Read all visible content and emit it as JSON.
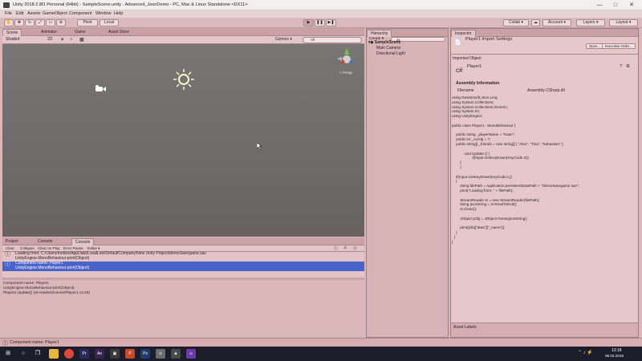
{
  "window": {
    "title": "Unity 2018.2.8f1 Personal (64bit) - SampleScene.unity - Advanced_JsonDemo - PC, Mac & Linux Standalone <DX11>",
    "controls": [
      "—",
      "□",
      "✕"
    ]
  },
  "menu": [
    "File",
    "Edit",
    "Assets",
    "GameObject",
    "Component",
    "Window",
    "Help"
  ],
  "toolbar": {
    "pivot": "Pivot",
    "local": "Local",
    "play_icon": "play-icon",
    "pause_icon": "pause-icon",
    "step_icon": "step-icon",
    "collab": "Collab ▾",
    "account": "Account ▾",
    "layers": "Layers ▾",
    "layout": "Layout ▾"
  },
  "scene_tabs": [
    "Scene",
    "Animator",
    "Game",
    "Asset Store"
  ],
  "scene_bar": {
    "shading": "Shaded",
    "mode": "2D",
    "gizmos": "Gizmos ▾",
    "search": "All"
  },
  "scene": {
    "persp": "< Persp"
  },
  "hierarchy": {
    "tab": "Hierarchy",
    "create": "Create ▾",
    "search": "All",
    "scene": "SampleScene",
    "items": [
      "Main Camera",
      "Directional Light"
    ]
  },
  "inspector": {
    "tab": "Inspector",
    "header": "Player1 Import Settings",
    "open": "Open...",
    "exec_order": "Execution Order...",
    "imported_label": "Imported Object",
    "object_name": "Player1",
    "assembly_title": "Assembly Information",
    "filename_label": "Filename",
    "filename_value": "Assembly-CSharp.dll",
    "code": "using Newtonsoft.Json.Linq;\nusing System.Collections;\nusing System.Collections.Generic;\nusing System.IO;\nusing UnityEngine;\n\npublic class Player1 : MonoBehaviour {\n\n    public string _playerName = \"Kaan\";\n    public int _curHp = ?;\n    public string[] _friends = new string[] { \"Alex\", \"Tina\", \"Sebastian\" };\n\n            void Update () {\n                    if(Input.GetKeyDown(KeyCode.S))\n        {\n        }\n\n    if(Input.GetKeyDown(KeyCode.L))\n    {\n        string filePath = Application.persistentDataPath + \"/demoSavegame.sav\";\n        print(\"Loading from: \" + filePath);\n\n        StreamReader sr = new StreamReader(filePath);\n        string jsonString = sr.ReadToEnd();\n        sr.Close();\n\n        JObject jObj = JObject.Parse(jsonString);\n\n        print(jObj[\"data\"][\"_name\"]);\n    }\n  }\n}",
    "asset_labels": "Asset Labels"
  },
  "bottom_tabs": [
    "Project",
    "Console",
    "Console"
  ],
  "console_bar": [
    "Clear",
    "Collapse",
    "Clear on Play",
    "Error Pause",
    "Editor ▾"
  ],
  "console_log": [
    {
      "line1": "Loading from: C:/Users/mettza/AppData/LocalLow/DefaultCompany/New Unity Project/demoSavegame.sav",
      "line2": "UnityEngine.MonoBehaviour:print(Object)"
    },
    {
      "line1": "Component name: Player1",
      "line2": "UnityEngine.MonoBehaviour:print(Object)"
    }
  ],
  "console_detail": "Component name: Player1\nUnityEngine.MonoBehaviour:print(Object)\nPlayer1:Update() (at Assets/Scenes/Player1.cs:28)",
  "status_bar": "Component name: Player1",
  "taskbar": {
    "icons": [
      "windows-icon",
      "search-icon",
      "task-view-icon",
      "explorer-icon",
      "chrome-icon",
      "premiere-icon",
      "after-effects-icon",
      "media-icon",
      "powerpoint-icon",
      "photoshop-icon",
      "gimp-icon",
      "unity-icon",
      "visual-studio-icon"
    ],
    "time": "13:18",
    "date": "06.02.2019"
  }
}
